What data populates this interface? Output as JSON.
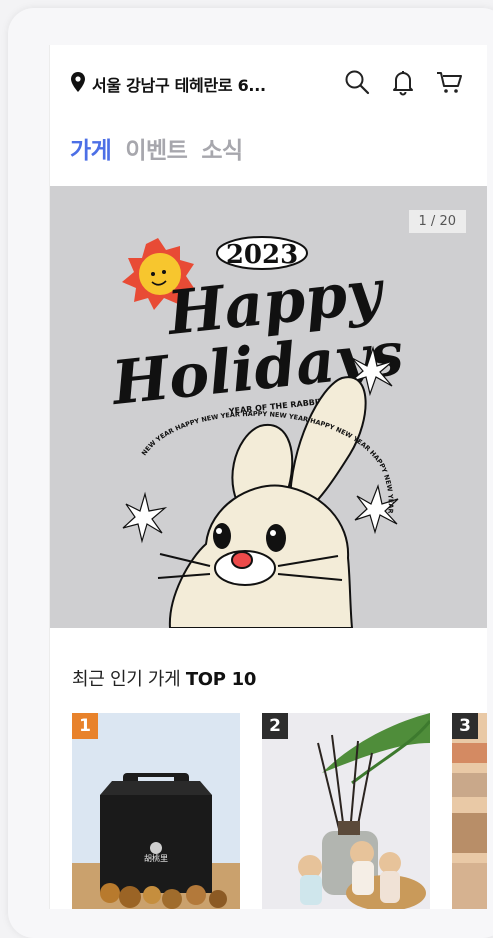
{
  "header": {
    "location": "서울 강남구 테헤란로 6..."
  },
  "tabs": [
    {
      "label": "가게",
      "active": true
    },
    {
      "label": "이벤트",
      "active": false
    },
    {
      "label": "소식",
      "active": false
    }
  ],
  "banner": {
    "counter": "1 / 20",
    "year": "2023",
    "line1": "Happy",
    "line2": "Holidays",
    "subtitle": "YEAR OF THE RABBIT",
    "ring_text": "NEW YEAR HAPPY NEW YEAR HAPPY NEW YEAR HAPPY NEW YEAR HAPPY NEW YEAR"
  },
  "section": {
    "prefix": "최근 인기 가게 ",
    "highlight": "TOP 10"
  },
  "cards": [
    {
      "rank": "1",
      "rank_color": "#e8822b",
      "box_label": "胡桃里"
    },
    {
      "rank": "2",
      "rank_color": "#2d2d2d"
    },
    {
      "rank": "3",
      "rank_color": "#2d2d2d"
    }
  ],
  "colors": {
    "accent": "#4c6fe6",
    "banner_bg": "#cfcfd1"
  }
}
